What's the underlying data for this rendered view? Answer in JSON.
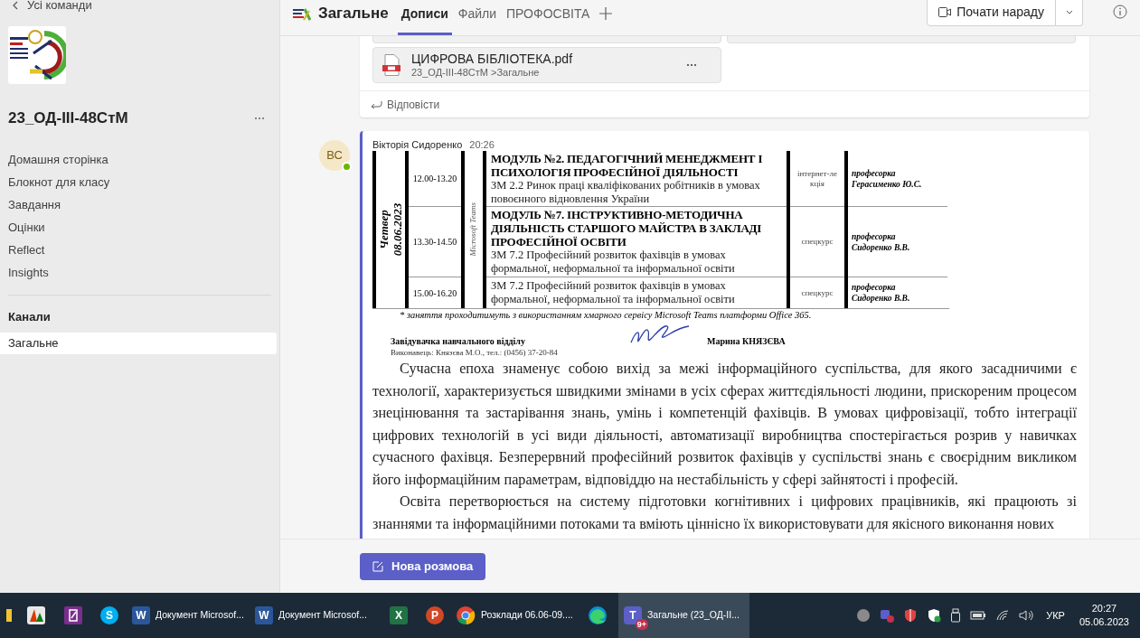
{
  "sidebar": {
    "back_link": "Усі команди",
    "team_name": "23_ОД-III-48СтМ",
    "nav_items": [
      "Домашня сторінка",
      "Блокнот для класу",
      "Завдання",
      "Оцінки",
      "Reflect",
      "Insights"
    ],
    "channels_heading": "Канали",
    "channels": [
      {
        "label": "Загальне",
        "selected": true
      }
    ]
  },
  "header": {
    "channel_title": "Загальне",
    "tabs": [
      {
        "label": "Дописи",
        "selected": true
      },
      {
        "label": "Файли",
        "selected": false
      },
      {
        "label": "ПРОФОСВІТА",
        "selected": false
      }
    ],
    "meet_button": "Почати нараду"
  },
  "post_1": {
    "attachment": {
      "file_name": "ЦИФРОВА БІБЛІОТЕКА.pdf",
      "path": "23_ОД-III-48СтМ >Загальне"
    },
    "reply_label": "Відповісти"
  },
  "post_2": {
    "avatar_initials": "ВС",
    "author": "Вікторія Сидоренко",
    "time": "20:26",
    "document": {
      "day": "Четвер",
      "date": "08.06.2023",
      "platform": "Microsoft Teams",
      "rows": [
        {
          "time": "12.00-13.20",
          "module": "МОДУЛЬ №2. ПЕДАГОГІЧНИЙ МЕНЕДЖМЕНТ І ПСИХОЛОГІЯ ПРОФЕСІЙНОЇ ДІЯЛЬНОСТІ",
          "topic": "ЗМ 2.2 Ринок праці кваліфікованих робітників в умовах повоєнного відновлення України",
          "type": "інтернет-лекція",
          "teacher_title": "професорка",
          "teacher": "Герасименко Ю.С."
        },
        {
          "time": "13.30-14.50",
          "module": "МОДУЛЬ №7. ІНСТРУКТИВНО-МЕТОДИЧНА ДІЯЛЬНІСТЬ СТАРШОГО МАЙСТРА В ЗАКЛАДІ ПРОФЕСІЙНОЇ ОСВІТИ",
          "topic": "ЗМ 7.2 Професійний розвиток фахівців в умовах формальної, неформальної та інформальної освіти",
          "type": "спецкурс",
          "teacher_title": "професорка",
          "teacher": "Сидоренко В.В."
        },
        {
          "time": "15.00-16.20",
          "topic": "ЗМ 7.2 Професійний розвиток фахівців в умовах формальної, неформальної та інформальної освіти",
          "type": "спецкурс",
          "teacher_title": "професорка",
          "teacher": "Сидоренко В.В."
        }
      ],
      "footnote": "* заняття проходитимуть з використанням хмарного сервісу Microsoft Teams платформи Office 365.",
      "signer_title": "Завідувачка  навчального відділу",
      "signer_name": "Марина КНЯЗЄВА",
      "executor": "Виконавець: Князєва М.О., тел.: (0456) 37-20-84"
    },
    "paragraphs": [
      "Сучасна епоха знаменує собою вихід за межі інформаційного суспільства, для якого засадничими є технології, характеризується швидкими змінами в усіх сферах життєдіяльності людини, прискореним процесом знецінювання та застарівання знань, умінь і компетенцій фахівців. В умовах цифровізації, тобто інтеграції цифрових технологій в усі види діяльності, автоматизації виробництва спостерігається розрив у навичках сучасного фахівця. Безперервний професійний розвиток фахівців у суспільстві знань є своєрідним викликом його інформаційним параметрам, відповіддю на нестабільність у сфері зайнятості і професій.",
      "Освіта перетворюється на систему підготовки когнітивних і цифрових працівників, які працюють зі знаннями та інформаційними потоками та вміють ціннісно їх використовувати для якісного виконання нових"
    ]
  },
  "new_conversation_button": "Нова розмова",
  "taskbar": {
    "items": [
      {
        "kind": "folder",
        "selected": false
      },
      {
        "kind": "chart",
        "selected": false
      },
      {
        "kind": "notebook",
        "selected": false
      },
      {
        "kind": "skype",
        "glyph": "S",
        "selected": false
      },
      {
        "kind": "word",
        "glyph": "W",
        "label": "Документ Microsof...",
        "selected": false
      },
      {
        "kind": "word",
        "glyph": "W",
        "label": "Документ Microsof...",
        "selected": false
      },
      {
        "kind": "excel",
        "glyph": "X",
        "selected": false
      },
      {
        "kind": "powerpoint",
        "glyph": "P",
        "selected": false
      },
      {
        "kind": "chrome",
        "label": "Розклади 06.06-09....",
        "selected": false
      },
      {
        "kind": "edge",
        "selected": false
      },
      {
        "kind": "teams",
        "glyph": "T",
        "badge": "9+",
        "label": "Загальне (23_ОД-ІІ...",
        "selected": true
      }
    ],
    "language": "УКР",
    "time": "20:27",
    "date": "05.06.2023"
  }
}
